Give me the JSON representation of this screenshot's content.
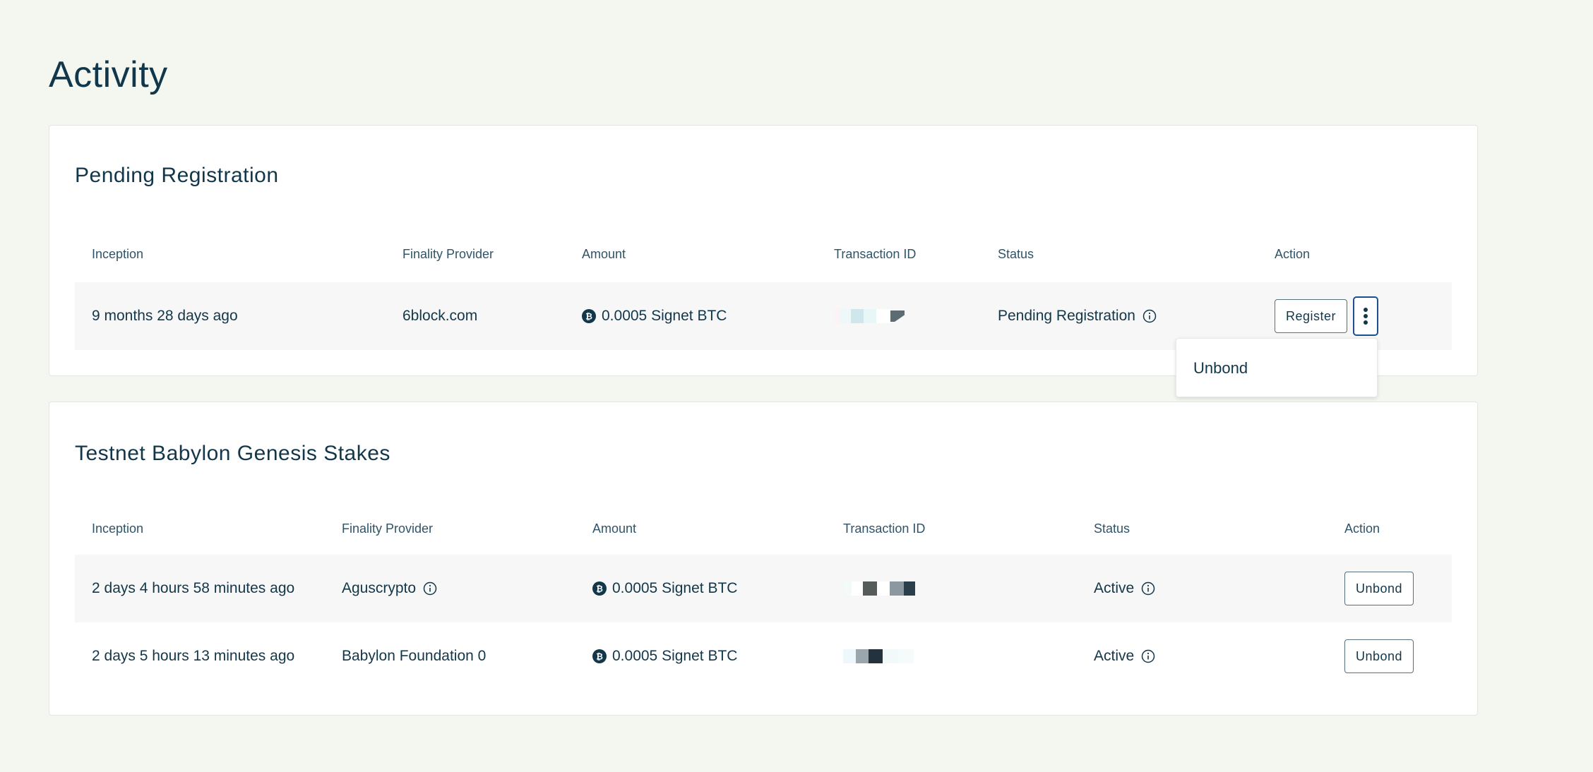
{
  "page": {
    "title": "Activity"
  },
  "pending": {
    "title": "Pending Registration",
    "columns": [
      "Inception",
      "Finality Provider",
      "Amount",
      "Transaction ID",
      "Status",
      "Action"
    ],
    "rows": [
      {
        "inception": "9 months 28 days ago",
        "provider": "6block.com",
        "amount": "0.0005 Signet BTC",
        "status": "Pending Registration",
        "action": "Register"
      }
    ],
    "menu": {
      "items": [
        "Unbond"
      ]
    }
  },
  "stakes": {
    "title": "Testnet Babylon Genesis Stakes",
    "columns": [
      "Inception",
      "Finality Provider",
      "Amount",
      "Transaction ID",
      "Status",
      "Action"
    ],
    "rows": [
      {
        "inception": "2 days 4 hours 58 minutes ago",
        "provider": "Aguscrypto",
        "amount": "0.0005 Signet BTC",
        "status": "Active",
        "action": "Unbond"
      },
      {
        "inception": "2 days 5 hours 13 minutes ago",
        "provider": "Babylon Foundation 0",
        "amount": "0.0005 Signet BTC",
        "status": "Active",
        "action": "Unbond"
      }
    ]
  },
  "icons": {
    "info": "info-circle-icon",
    "btc": "bitcoin-icon",
    "menu": "kebab-menu-icon"
  },
  "colors": {
    "background": "#f4f6f0",
    "text": "#12374a",
    "focus_border": "#1d4f8e"
  }
}
